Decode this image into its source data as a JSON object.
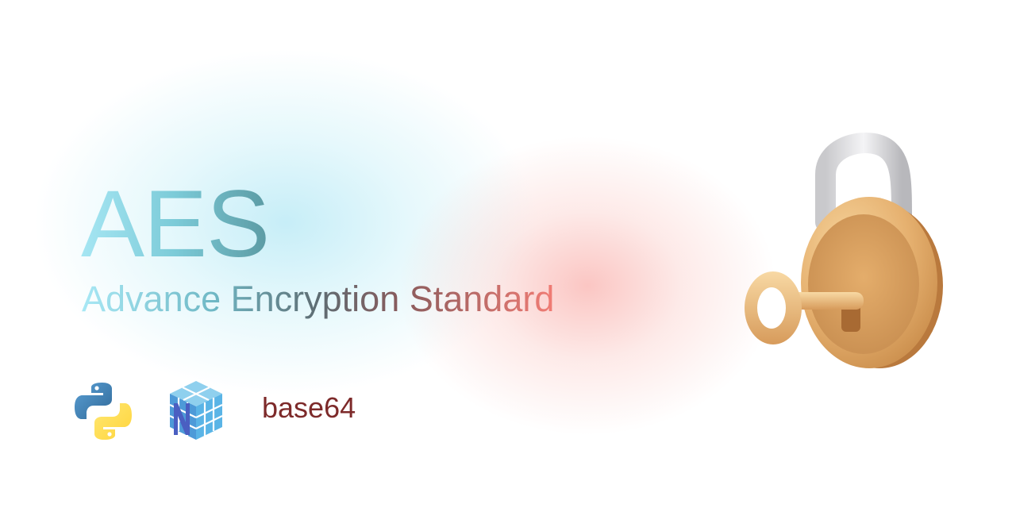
{
  "header": {
    "title": "AES",
    "subtitle": "Advance Encryption Standard"
  },
  "tools": {
    "icons": [
      "python-logo",
      "numpy-logo",
      "padlock-key-icon"
    ],
    "base64_label": "base64"
  },
  "colors": {
    "title_gradient": [
      "#a6e6f3",
      "#5b9aa3"
    ],
    "subtitle_gradient": [
      "#a8e8f5",
      "#5e6c72",
      "#f17c74"
    ],
    "base64": "#7d2a2a",
    "glow_cyan": "#b4e8f5",
    "glow_red": "#f8a09b"
  }
}
